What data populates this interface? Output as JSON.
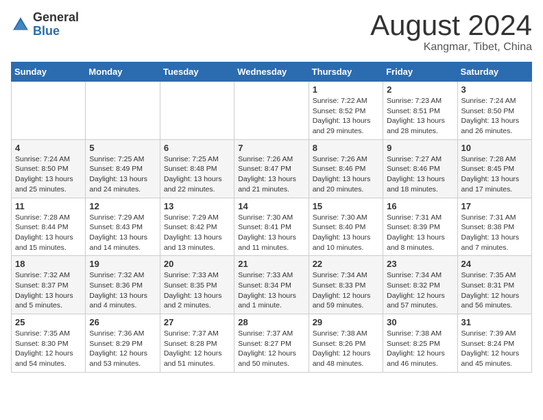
{
  "logo": {
    "general": "General",
    "blue": "Blue"
  },
  "title": "August 2024",
  "subtitle": "Kangmar, Tibet, China",
  "weekdays": [
    "Sunday",
    "Monday",
    "Tuesday",
    "Wednesday",
    "Thursday",
    "Friday",
    "Saturday"
  ],
  "weeks": [
    [
      {
        "day": "",
        "info": ""
      },
      {
        "day": "",
        "info": ""
      },
      {
        "day": "",
        "info": ""
      },
      {
        "day": "",
        "info": ""
      },
      {
        "day": "1",
        "info": "Sunrise: 7:22 AM\nSunset: 8:52 PM\nDaylight: 13 hours\nand 29 minutes."
      },
      {
        "day": "2",
        "info": "Sunrise: 7:23 AM\nSunset: 8:51 PM\nDaylight: 13 hours\nand 28 minutes."
      },
      {
        "day": "3",
        "info": "Sunrise: 7:24 AM\nSunset: 8:50 PM\nDaylight: 13 hours\nand 26 minutes."
      }
    ],
    [
      {
        "day": "4",
        "info": "Sunrise: 7:24 AM\nSunset: 8:50 PM\nDaylight: 13 hours\nand 25 minutes."
      },
      {
        "day": "5",
        "info": "Sunrise: 7:25 AM\nSunset: 8:49 PM\nDaylight: 13 hours\nand 24 minutes."
      },
      {
        "day": "6",
        "info": "Sunrise: 7:25 AM\nSunset: 8:48 PM\nDaylight: 13 hours\nand 22 minutes."
      },
      {
        "day": "7",
        "info": "Sunrise: 7:26 AM\nSunset: 8:47 PM\nDaylight: 13 hours\nand 21 minutes."
      },
      {
        "day": "8",
        "info": "Sunrise: 7:26 AM\nSunset: 8:46 PM\nDaylight: 13 hours\nand 20 minutes."
      },
      {
        "day": "9",
        "info": "Sunrise: 7:27 AM\nSunset: 8:46 PM\nDaylight: 13 hours\nand 18 minutes."
      },
      {
        "day": "10",
        "info": "Sunrise: 7:28 AM\nSunset: 8:45 PM\nDaylight: 13 hours\nand 17 minutes."
      }
    ],
    [
      {
        "day": "11",
        "info": "Sunrise: 7:28 AM\nSunset: 8:44 PM\nDaylight: 13 hours\nand 15 minutes."
      },
      {
        "day": "12",
        "info": "Sunrise: 7:29 AM\nSunset: 8:43 PM\nDaylight: 13 hours\nand 14 minutes."
      },
      {
        "day": "13",
        "info": "Sunrise: 7:29 AM\nSunset: 8:42 PM\nDaylight: 13 hours\nand 13 minutes."
      },
      {
        "day": "14",
        "info": "Sunrise: 7:30 AM\nSunset: 8:41 PM\nDaylight: 13 hours\nand 11 minutes."
      },
      {
        "day": "15",
        "info": "Sunrise: 7:30 AM\nSunset: 8:40 PM\nDaylight: 13 hours\nand 10 minutes."
      },
      {
        "day": "16",
        "info": "Sunrise: 7:31 AM\nSunset: 8:39 PM\nDaylight: 13 hours\nand 8 minutes."
      },
      {
        "day": "17",
        "info": "Sunrise: 7:31 AM\nSunset: 8:38 PM\nDaylight: 13 hours\nand 7 minutes."
      }
    ],
    [
      {
        "day": "18",
        "info": "Sunrise: 7:32 AM\nSunset: 8:37 PM\nDaylight: 13 hours\nand 5 minutes."
      },
      {
        "day": "19",
        "info": "Sunrise: 7:32 AM\nSunset: 8:36 PM\nDaylight: 13 hours\nand 4 minutes."
      },
      {
        "day": "20",
        "info": "Sunrise: 7:33 AM\nSunset: 8:35 PM\nDaylight: 13 hours\nand 2 minutes."
      },
      {
        "day": "21",
        "info": "Sunrise: 7:33 AM\nSunset: 8:34 PM\nDaylight: 13 hours\nand 1 minute."
      },
      {
        "day": "22",
        "info": "Sunrise: 7:34 AM\nSunset: 8:33 PM\nDaylight: 12 hours\nand 59 minutes."
      },
      {
        "day": "23",
        "info": "Sunrise: 7:34 AM\nSunset: 8:32 PM\nDaylight: 12 hours\nand 57 minutes."
      },
      {
        "day": "24",
        "info": "Sunrise: 7:35 AM\nSunset: 8:31 PM\nDaylight: 12 hours\nand 56 minutes."
      }
    ],
    [
      {
        "day": "25",
        "info": "Sunrise: 7:35 AM\nSunset: 8:30 PM\nDaylight: 12 hours\nand 54 minutes."
      },
      {
        "day": "26",
        "info": "Sunrise: 7:36 AM\nSunset: 8:29 PM\nDaylight: 12 hours\nand 53 minutes."
      },
      {
        "day": "27",
        "info": "Sunrise: 7:37 AM\nSunset: 8:28 PM\nDaylight: 12 hours\nand 51 minutes."
      },
      {
        "day": "28",
        "info": "Sunrise: 7:37 AM\nSunset: 8:27 PM\nDaylight: 12 hours\nand 50 minutes."
      },
      {
        "day": "29",
        "info": "Sunrise: 7:38 AM\nSunset: 8:26 PM\nDaylight: 12 hours\nand 48 minutes."
      },
      {
        "day": "30",
        "info": "Sunrise: 7:38 AM\nSunset: 8:25 PM\nDaylight: 12 hours\nand 46 minutes."
      },
      {
        "day": "31",
        "info": "Sunrise: 7:39 AM\nSunset: 8:24 PM\nDaylight: 12 hours\nand 45 minutes."
      }
    ]
  ]
}
